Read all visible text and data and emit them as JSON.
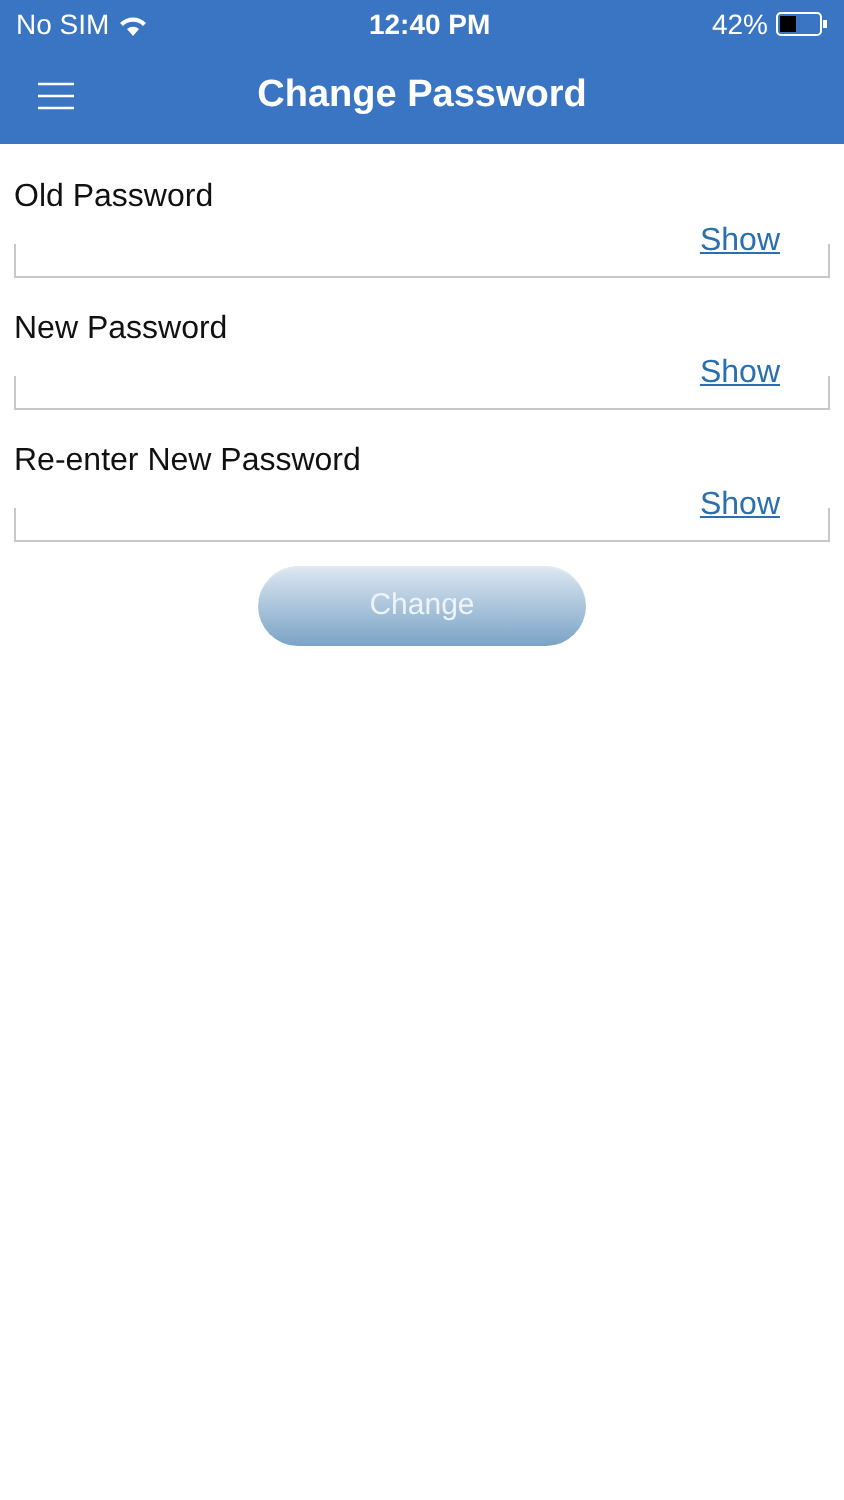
{
  "status_bar": {
    "carrier": "No SIM",
    "time": "12:40 PM",
    "battery": "42%"
  },
  "header": {
    "title": "Change Password"
  },
  "fields": [
    {
      "label": "Old Password",
      "toggle": "Show"
    },
    {
      "label": "New Password",
      "toggle": "Show"
    },
    {
      "label": "Re-enter New Password",
      "toggle": "Show"
    }
  ],
  "submit": {
    "label": "Change",
    "disabled": true
  }
}
